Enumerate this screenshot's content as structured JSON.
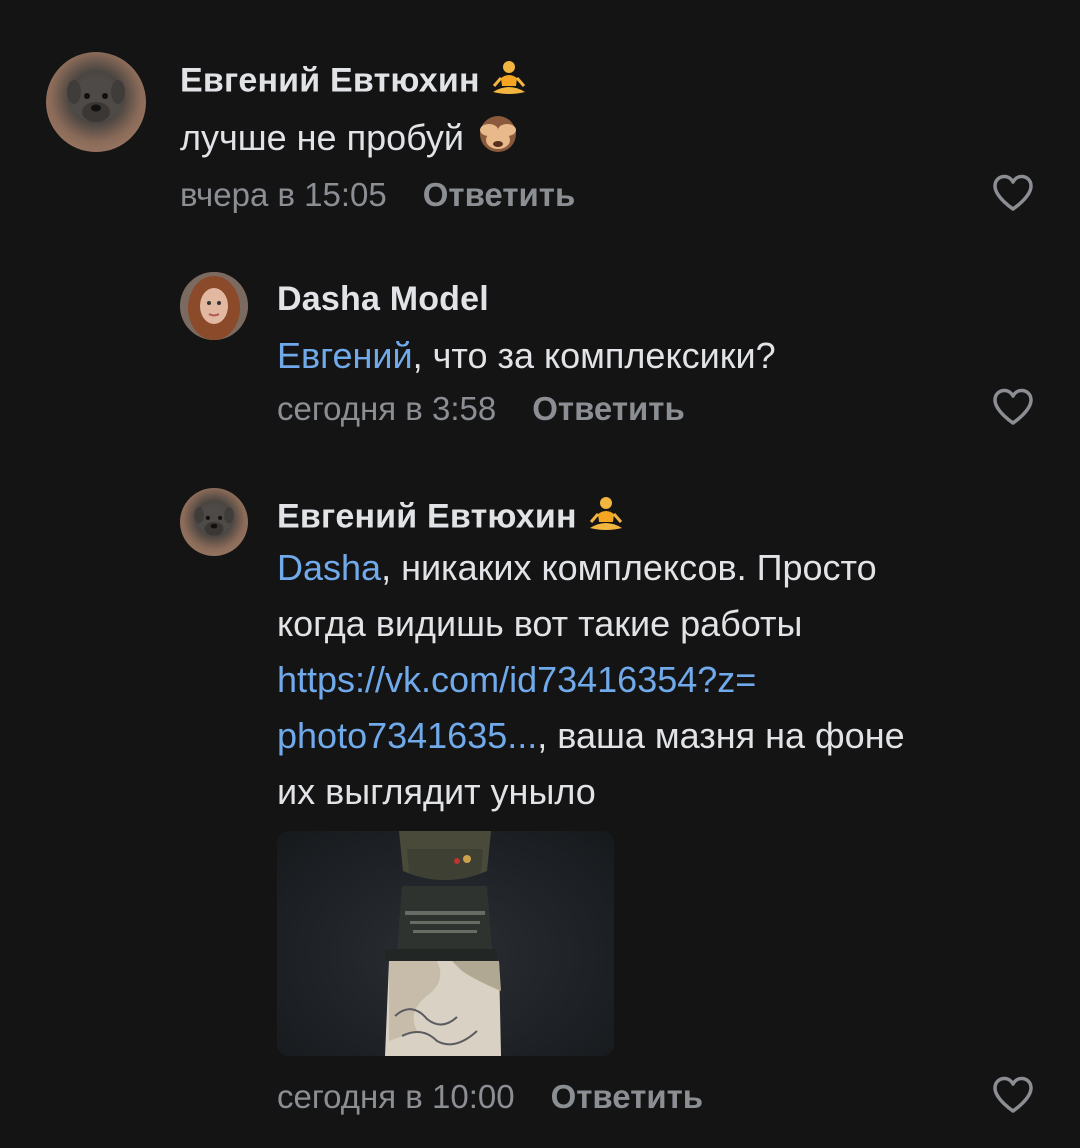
{
  "comments": [
    {
      "author": "Евгений Евтюхин",
      "author_emoji": "lotus-position-emoji",
      "text": "лучше не пробуй",
      "text_emoji": "see-no-evil-monkey-emoji",
      "timestamp": "вчера в 15:05",
      "reply_label": "Ответить",
      "avatar": "dog-avatar-icon"
    },
    {
      "author": "Dasha Model",
      "mention": "Евгений",
      "text": ", что за комплексики?",
      "timestamp": "сегодня в 3:58",
      "reply_label": "Ответить",
      "avatar": "woman-avatar-icon"
    },
    {
      "author": "Евгений Евтюхин",
      "author_emoji": "lotus-position-emoji",
      "mention": "Dasha",
      "text_line1": ", никаких комплексов. Просто",
      "text_line2": "когда видишь вот такие работы",
      "link_line1": "https://vk.com/id73416354?z=",
      "link_line2": "photo7341635...",
      "text_line4": ", ваша мазня на фоне",
      "text_line5": "их выглядит уныло",
      "photo_subject": "painted-bust-figure-photo",
      "timestamp": "сегодня в 10:00",
      "reply_label": "Ответить",
      "avatar": "dog-avatar-icon"
    }
  ],
  "colors": {
    "background": "#141414",
    "text": "#e1e3e6",
    "secondary": "#8b8e93",
    "link": "#71aaeb"
  }
}
